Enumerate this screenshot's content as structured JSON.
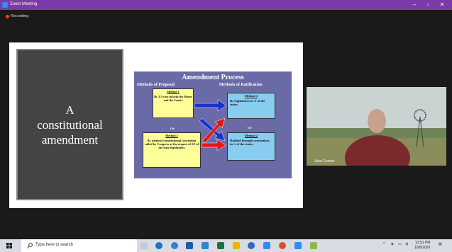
{
  "window": {
    "title": "Zoom Meeting"
  },
  "recording": {
    "label": "Recording"
  },
  "slide": {
    "left_text": [
      "A",
      "constitutional",
      "amendment"
    ],
    "diagram": {
      "title": "Amendment Process",
      "proposal_header": "Methods of Proposal",
      "ratification_header": "Methods of Ratification",
      "proposal_1": {
        "heading": "Method 1",
        "text": "By 2/3 vote in both the House and the Senate"
      },
      "proposal_2": {
        "heading": "Method 2",
        "text": "By national constitutional convention called by Congress at the request of 2/3 of the state legislatures"
      },
      "ratification_1": {
        "heading": "Method 1",
        "text": "By legislatures in ¾ of the states"
      },
      "ratification_2": {
        "heading": "Method 2",
        "text": "Ratified through conventions in ¾ of the states."
      },
      "or_label": "Or"
    }
  },
  "video": {
    "participant_name": "John Conner"
  },
  "taskbar": {
    "search_placeholder": "Type here to search",
    "time": "12:51 PM",
    "date": "10/8/2020"
  },
  "colors": {
    "titlebar": "#7a3ba8",
    "zoom_blue": "#2d8cff"
  }
}
